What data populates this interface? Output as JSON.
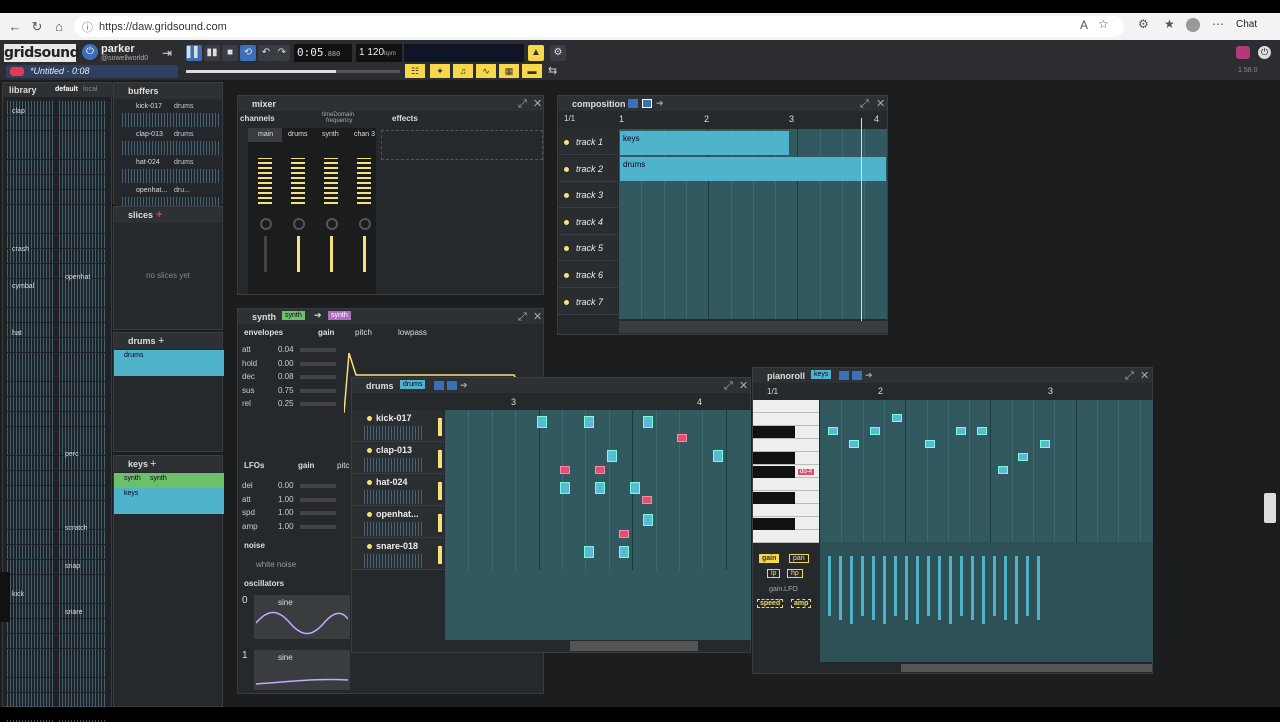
{
  "browser": {
    "url": "https://daw.gridsound.com",
    "chat_label": "Chat"
  },
  "app": {
    "logo": "gridsound",
    "user": {
      "name": "parker",
      "handle": "@sowellworld0"
    },
    "clock": "0:05",
    "clock_ms": ".880",
    "beat": "1",
    "bpm": "120",
    "bpm_unit": "bpm",
    "project_title": "*Untitled · 0:08",
    "version": "1.58.0"
  },
  "library": {
    "tab_label": "library",
    "tab_default": "default",
    "tab_local": "local",
    "items": [
      "clap",
      "crash",
      "openhat",
      "cymbal",
      "hat",
      "perc",
      "scratch",
      "snap",
      "kick",
      "snare"
    ]
  },
  "buffers": {
    "title": "buffers",
    "items": [
      {
        "name": "kick-017",
        "tag": "drums"
      },
      {
        "name": "clap-013",
        "tag": "drums"
      },
      {
        "name": "hat-024",
        "tag": "drums"
      },
      {
        "name": "openhat...",
        "tag": "dru..."
      }
    ]
  },
  "slices": {
    "title": "slices",
    "empty": "no slices yet"
  },
  "drums_list": {
    "title": "drums",
    "item": "drums"
  },
  "keys_list": {
    "title": "keys",
    "synth_a": "synth",
    "synth_b": "synth",
    "item": "keys"
  },
  "mixer": {
    "title": "mixer",
    "tab_channels": "channels",
    "tab_time": "timeDomain",
    "tab_freq": "frequency",
    "tab_effects": "effects",
    "channels": [
      "main",
      "drums",
      "synth",
      "chan 3"
    ]
  },
  "composition": {
    "title": "composition",
    "measure": "1/1",
    "ruler": [
      "1",
      "2",
      "3",
      "4"
    ],
    "tracks": [
      "track 1",
      "track 2",
      "track 3",
      "track 4",
      "track 5",
      "track 6",
      "track 7"
    ],
    "clips": [
      {
        "label": "keys"
      },
      {
        "label": "drums"
      }
    ]
  },
  "synth": {
    "title": "synth",
    "tag_a": "synth",
    "tag_b": "synth",
    "envelopes_label": "envelopes",
    "env_tabs": [
      "gain",
      "pitch",
      "lowpass"
    ],
    "env": [
      {
        "k": "att",
        "v": "0.04"
      },
      {
        "k": "hold",
        "v": "0.00"
      },
      {
        "k": "dec",
        "v": "0.08"
      },
      {
        "k": "sus",
        "v": "0.75"
      },
      {
        "k": "rel",
        "v": "0.25"
      }
    ],
    "lfos_label": "LFOs",
    "lfo_tab_gain": "gain",
    "lfo_tab_pitch": "pitc",
    "lfo": [
      {
        "k": "del",
        "v": "0.00"
      },
      {
        "k": "att",
        "v": "1.00"
      },
      {
        "k": "spd",
        "v": "1.00"
      },
      {
        "k": "amp",
        "v": "1.00"
      }
    ],
    "noise_label": "noise",
    "noise_type": "white noise",
    "osc_label": "oscillators",
    "oscillators": [
      {
        "idx": "0",
        "wave": "sine"
      },
      {
        "idx": "1",
        "wave": "sine"
      }
    ]
  },
  "drums": {
    "title": "drums",
    "tag": "drums",
    "ruler": [
      "3",
      "4"
    ],
    "channels": [
      "kick-017",
      "clap-013",
      "hat-024",
      "openhat...",
      "snare-018"
    ]
  },
  "pianoroll": {
    "title": "pianoroll",
    "tag": "keys",
    "measure": "1/1",
    "ruler": [
      "2",
      "3"
    ],
    "key_label": "do-4",
    "props": [
      "gain",
      "pan",
      "lp",
      "hp"
    ],
    "prop_sel": "gain.LFO",
    "props2": [
      "speed",
      "amp"
    ]
  },
  "colors": {
    "accent": "#f6d84a",
    "clip": "#4fb3cc",
    "grid": "#31595f",
    "note_red": "#e05072"
  }
}
